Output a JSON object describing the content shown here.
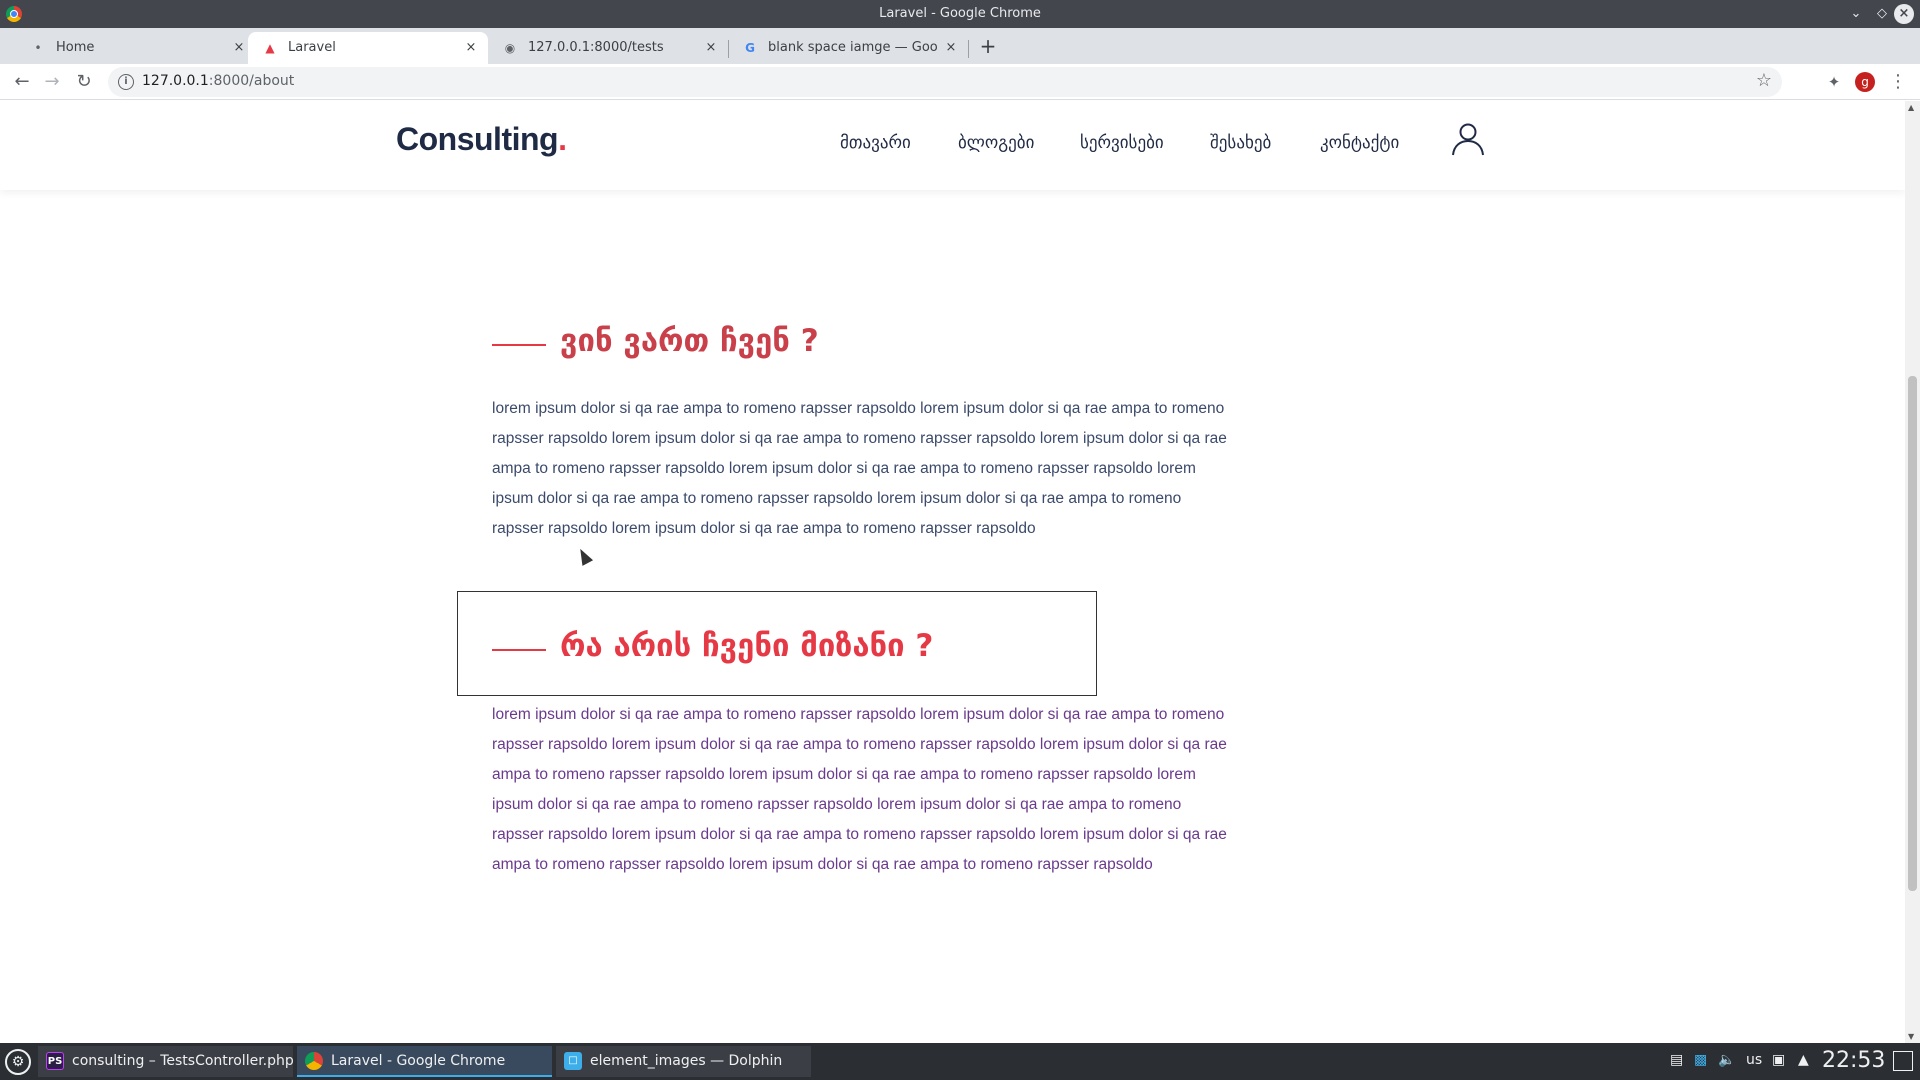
{
  "window": {
    "title": "Laravel - Google Chrome"
  },
  "tabs": [
    {
      "label": "Home",
      "icon": "page-icon"
    },
    {
      "label": "Laravel",
      "icon": "laravel-icon"
    },
    {
      "label": "127.0.0.1:8000/tests",
      "icon": "globe-icon"
    },
    {
      "label": "blank space iamge — Google",
      "icon": "google-icon"
    }
  ],
  "toolbar": {
    "url_host": "127.0.0.1",
    "url_path": ":8000/about",
    "profile_initial": "g"
  },
  "site": {
    "logo": "Consulting",
    "logo_dot": ".",
    "nav": [
      "მთავარი",
      "ბლოგები",
      "სერვისები",
      "შესახებ",
      "კონტაქტი"
    ],
    "sections": [
      {
        "title": "ვინ ვართ ჩვენ ?",
        "body": "lorem ipsum dolor si qa rae ampa to romeno rapsser rapsoldo lorem ipsum dolor si qa rae ampa to romeno rapsser rapsoldo lorem ipsum dolor si qa rae ampa to romeno rapsser rapsoldo lorem ipsum dolor si qa rae ampa to romeno rapsser rapsoldo lorem ipsum dolor si qa rae ampa to romeno rapsser rapsoldo lorem ipsum dolor si qa rae ampa to romeno rapsser rapsoldo lorem ipsum dolor si qa rae ampa to romeno rapsser rapsoldo lorem ipsum dolor si qa rae ampa to romeno rapsser rapsoldo"
      },
      {
        "title": "რა არის ჩვენი მიზანი ?",
        "body": "lorem ipsum dolor si qa rae ampa to romeno rapsser rapsoldo lorem ipsum dolor si qa rae ampa to romeno rapsser rapsoldo lorem ipsum dolor si qa rae ampa to romeno rapsser rapsoldo lorem ipsum dolor si qa rae ampa to romeno rapsser rapsoldo lorem ipsum dolor si qa rae ampa to romeno rapsser rapsoldo lorem ipsum dolor si qa rae ampa to romeno rapsser rapsoldo lorem ipsum dolor si qa rae ampa to romeno rapsser rapsoldo lorem ipsum dolor si qa rae ampa to romeno rapsser rapsoldo lorem ipsum dolor si qa rae ampa to romeno rapsser rapsoldo lorem ipsum dolor si qa rae ampa to romeno rapsser rapsoldo"
      }
    ]
  },
  "taskbar": {
    "tasks": [
      {
        "label": "consulting – TestsController.php",
        "icon": "phpstorm-icon"
      },
      {
        "label": "Laravel - Google Chrome",
        "icon": "chrome-icon"
      },
      {
        "label": "element_images — Dolphin",
        "icon": "folder-icon"
      }
    ],
    "keyboard_layout": "us",
    "clock": "22:53"
  },
  "colors": {
    "accent": "#e63946",
    "heading_dark": "#1f2a44",
    "titlebar": "#43474d",
    "taskbar": "#2b2e33"
  }
}
